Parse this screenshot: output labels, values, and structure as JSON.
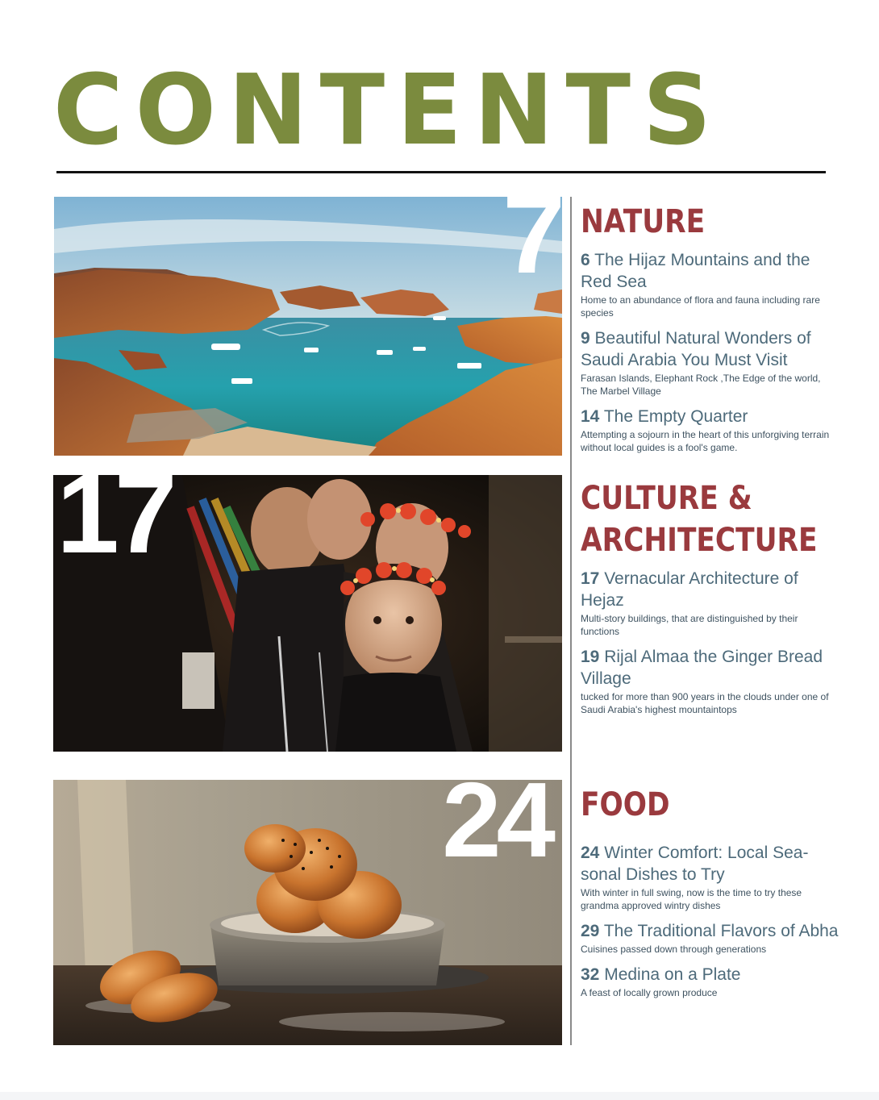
{
  "title": "CONTENTS",
  "sections": [
    {
      "heading": "NATURE",
      "feature_page": "7",
      "photo_icon": "sea-cove-photo",
      "entries": [
        {
          "page": "6",
          "title": "The Hijaz Mountains and the Red Sea",
          "desc": "Home to an abundance of flora and fauna including rare species"
        },
        {
          "page": "9",
          "title": "Beautiful Natural Wonders of Saudi Arabia You Must Visit",
          "desc": "Farasan Islands, Elephant Rock ,The Edge of the world, The Marbel Village"
        },
        {
          "page": "14",
          "title": "The Empty Quarter",
          "desc": "Attempting a sojourn in the heart of this unforgiving terrain without local guides is a fool's game."
        }
      ]
    },
    {
      "heading_line1": "CULTURE &",
      "heading_line2": "ARCHITECTURE",
      "feature_page": "17",
      "photo_icon": "children-flower-crowns-photo",
      "entries": [
        {
          "page": "17",
          "title": "Vernacular Architecture of Hejaz",
          "desc": "Multi-story buildings, that are distinguished by their functions"
        },
        {
          "page": "19",
          "title": "Rijal Almaa the Ginger Bread Village",
          "desc": "tucked for more than 900 years in the clouds under one of Saudi Arabia's highest mountaintops"
        }
      ]
    },
    {
      "heading": "FOOD",
      "feature_page": "24",
      "photo_icon": "pastry-bowl-photo",
      "entries": [
        {
          "page": "24",
          "title": "Winter Comfort: Local Sea-sonal Dishes to Try",
          "desc": "With winter in full swing, now is the time to try these grandma approved wintry dishes"
        },
        {
          "page": "29",
          "title": "The Traditional Flavors of Abha",
          "desc": "Cuisines passed down through generations"
        },
        {
          "page": "32",
          "title": "Medina on a Plate",
          "desc": "A feast of locally grown produce"
        }
      ]
    }
  ],
  "colors": {
    "title": "#7b8b3e",
    "heading": "#9a3a3e",
    "entry": "#4d6a7a"
  }
}
